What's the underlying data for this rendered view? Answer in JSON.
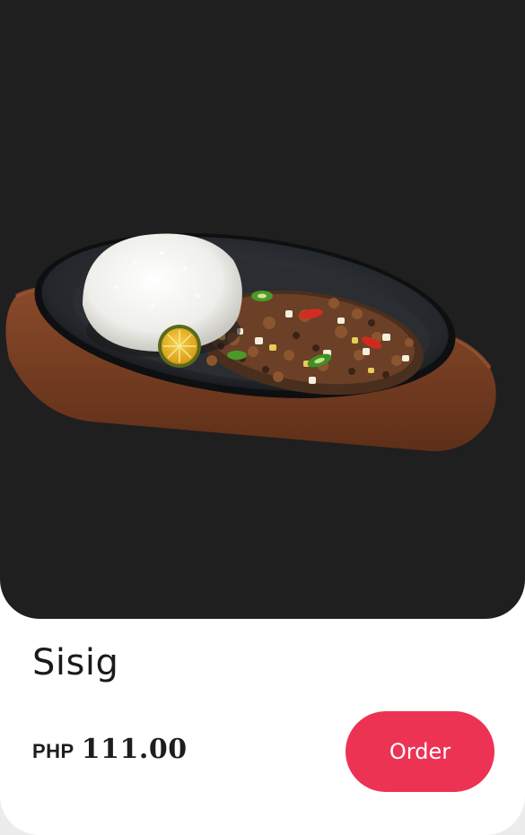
{
  "product": {
    "name": "Sisig",
    "currency": "PHP",
    "price": "111.00",
    "image_icon": "sisig-sizzling-plate-image"
  },
  "actions": {
    "order_label": "Order"
  },
  "colors": {
    "accent": "#ec3354",
    "hero_background": "#1f1f1f",
    "card_background": "#ffffff"
  }
}
